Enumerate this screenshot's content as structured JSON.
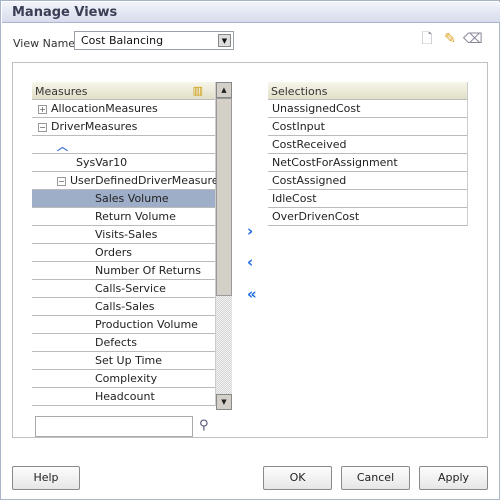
{
  "dialog": {
    "title": "Manage Views"
  },
  "view_name": {
    "label": "View Name",
    "value": "Cost Balancing"
  },
  "toolbar": {
    "icons": [
      "new-document-icon",
      "edit-pencil-icon",
      "clear-icon"
    ]
  },
  "measures": {
    "header": "Measures",
    "rows": [
      {
        "label": "AllocationMeasures",
        "expander": "+",
        "indent": 0
      },
      {
        "label": "DriverMeasures",
        "expander": "−",
        "indent": 0
      },
      {
        "label": "",
        "icon": "up-chevron-icon",
        "indent": 1
      },
      {
        "label": "SysVar10",
        "indent": 2
      },
      {
        "label": "UserDefinedDriverMeasures",
        "expander": "−",
        "indent": 1
      },
      {
        "label": "Sales Volume",
        "indent": 3,
        "selected": true
      },
      {
        "label": "Return Volume",
        "indent": 3
      },
      {
        "label": "Visits-Sales",
        "indent": 3
      },
      {
        "label": "Orders",
        "indent": 3
      },
      {
        "label": "Number Of Returns",
        "indent": 3
      },
      {
        "label": "Calls-Service",
        "indent": 3
      },
      {
        "label": "Calls-Sales",
        "indent": 3
      },
      {
        "label": "Production Volume",
        "indent": 3
      },
      {
        "label": "Defects",
        "indent": 3
      },
      {
        "label": "Set Up Time",
        "indent": 3
      },
      {
        "label": "Complexity",
        "indent": 3
      },
      {
        "label": "Headcount",
        "indent": 3
      }
    ]
  },
  "selections": {
    "header": "Selections",
    "rows": [
      "UnassignedCost",
      "CostInput",
      "CostReceived",
      "NetCostForAssignment",
      "CostAssigned",
      "IdleCost",
      "OverDrivenCost"
    ]
  },
  "search": {
    "value": ""
  },
  "buttons": {
    "help": "Help",
    "ok": "OK",
    "cancel": "Cancel",
    "apply": "Apply"
  },
  "colors": {
    "accent": "#1c6ae0",
    "selected_row": "#9eaec8"
  }
}
